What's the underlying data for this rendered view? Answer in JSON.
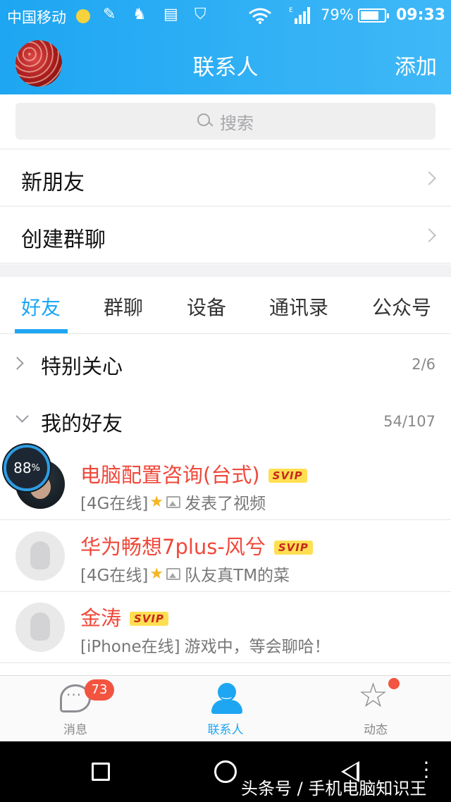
{
  "status_bar": {
    "carrier": "中国移动",
    "battery_percent": "79%",
    "battery_level": 0.79,
    "time": "09:33",
    "network": "E"
  },
  "header": {
    "title": "联系人",
    "add_label": "添加"
  },
  "search": {
    "placeholder": "搜索"
  },
  "links": [
    {
      "label": "新朋友"
    },
    {
      "label": "创建群聊"
    }
  ],
  "tabs": [
    {
      "label": "好友",
      "active": true
    },
    {
      "label": "群聊"
    },
    {
      "label": "设备"
    },
    {
      "label": "通讯录"
    },
    {
      "label": "公众号"
    }
  ],
  "groups": [
    {
      "name": "特别关心",
      "count": "2/6",
      "expanded": false
    },
    {
      "name": "我的好友",
      "count": "54/107",
      "expanded": true
    }
  ],
  "friends": [
    {
      "name": "电脑配置咨询(台式)",
      "badge": "SVIP",
      "status_prefix": "[4G在线]",
      "status_text": "发表了视频",
      "star": "★"
    },
    {
      "name": "华为畅想7plus-风兮",
      "badge": "SVIP",
      "status_prefix": "[4G在线]",
      "status_text": "队友真TM的菜",
      "star": "★"
    },
    {
      "name": "金涛",
      "badge": "SVIP",
      "status_prefix": "[iPhone在线]",
      "status_text": "游戏中，等会聊哈！"
    }
  ],
  "boost": {
    "value": "88",
    "unit": "%"
  },
  "tabbar": {
    "messages_label": "消息",
    "messages_badge": "73",
    "contacts_label": "联系人",
    "moments_label": "动态"
  },
  "watermark": "头条号 / 手机电脑知识王",
  "colors": {
    "accent": "#1ea6f2",
    "vip_name": "#f0483a",
    "badge_red": "#f2543f",
    "svip_bg": "#ffdf52"
  }
}
